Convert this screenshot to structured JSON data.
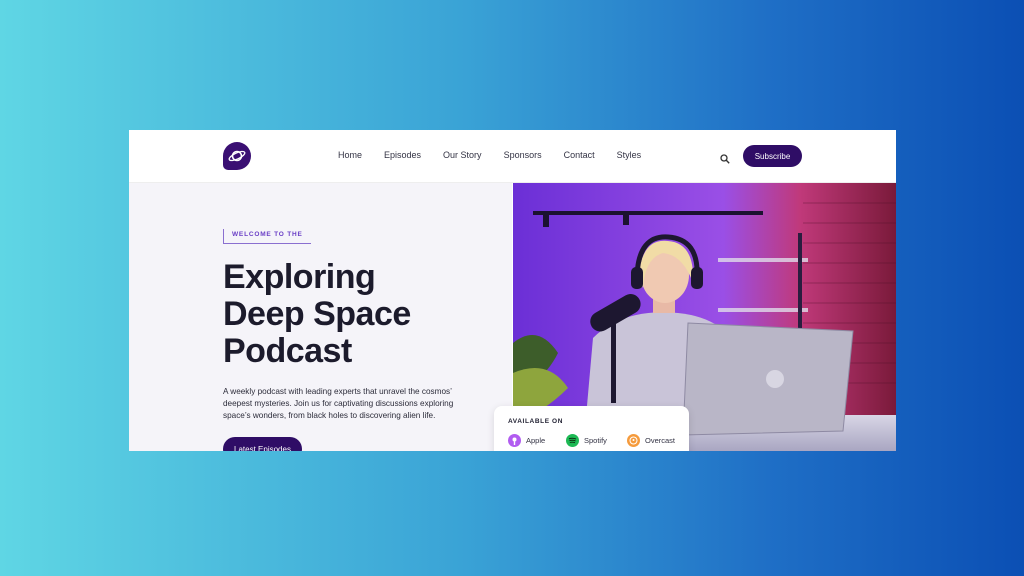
{
  "nav": {
    "items": [
      {
        "label": "Home"
      },
      {
        "label": "Episodes"
      },
      {
        "label": "Our Story"
      },
      {
        "label": "Sponsors"
      },
      {
        "label": "Contact"
      },
      {
        "label": "Styles"
      }
    ],
    "subscribe_label": "Subscribe",
    "logo_icon": "planet-icon",
    "search_icon": "search-icon"
  },
  "hero": {
    "eyebrow": "WELCOME TO THE",
    "headline_line1": "Exploring",
    "headline_line2": "Deep Space",
    "headline_line3": "Podcast",
    "description": "A weekly podcast with leading experts that unravel the cosmos’ deepest mysteries. Join us for captivating discussions exploring space’s wonders, from black holes to discovering alien life.",
    "cta_label": "Latest Episodes"
  },
  "available": {
    "title": "AVAILABLE ON",
    "platforms": [
      {
        "label": "Apple",
        "icon": "apple-podcasts-icon",
        "color": "#b15cf0"
      },
      {
        "label": "Spotify",
        "icon": "spotify-icon",
        "color": "#1db954"
      },
      {
        "label": "Overcast",
        "icon": "overcast-icon",
        "color": "#f59b3d"
      }
    ]
  },
  "colors": {
    "brand": "#2f0d66",
    "accent": "#6a3fc6"
  }
}
